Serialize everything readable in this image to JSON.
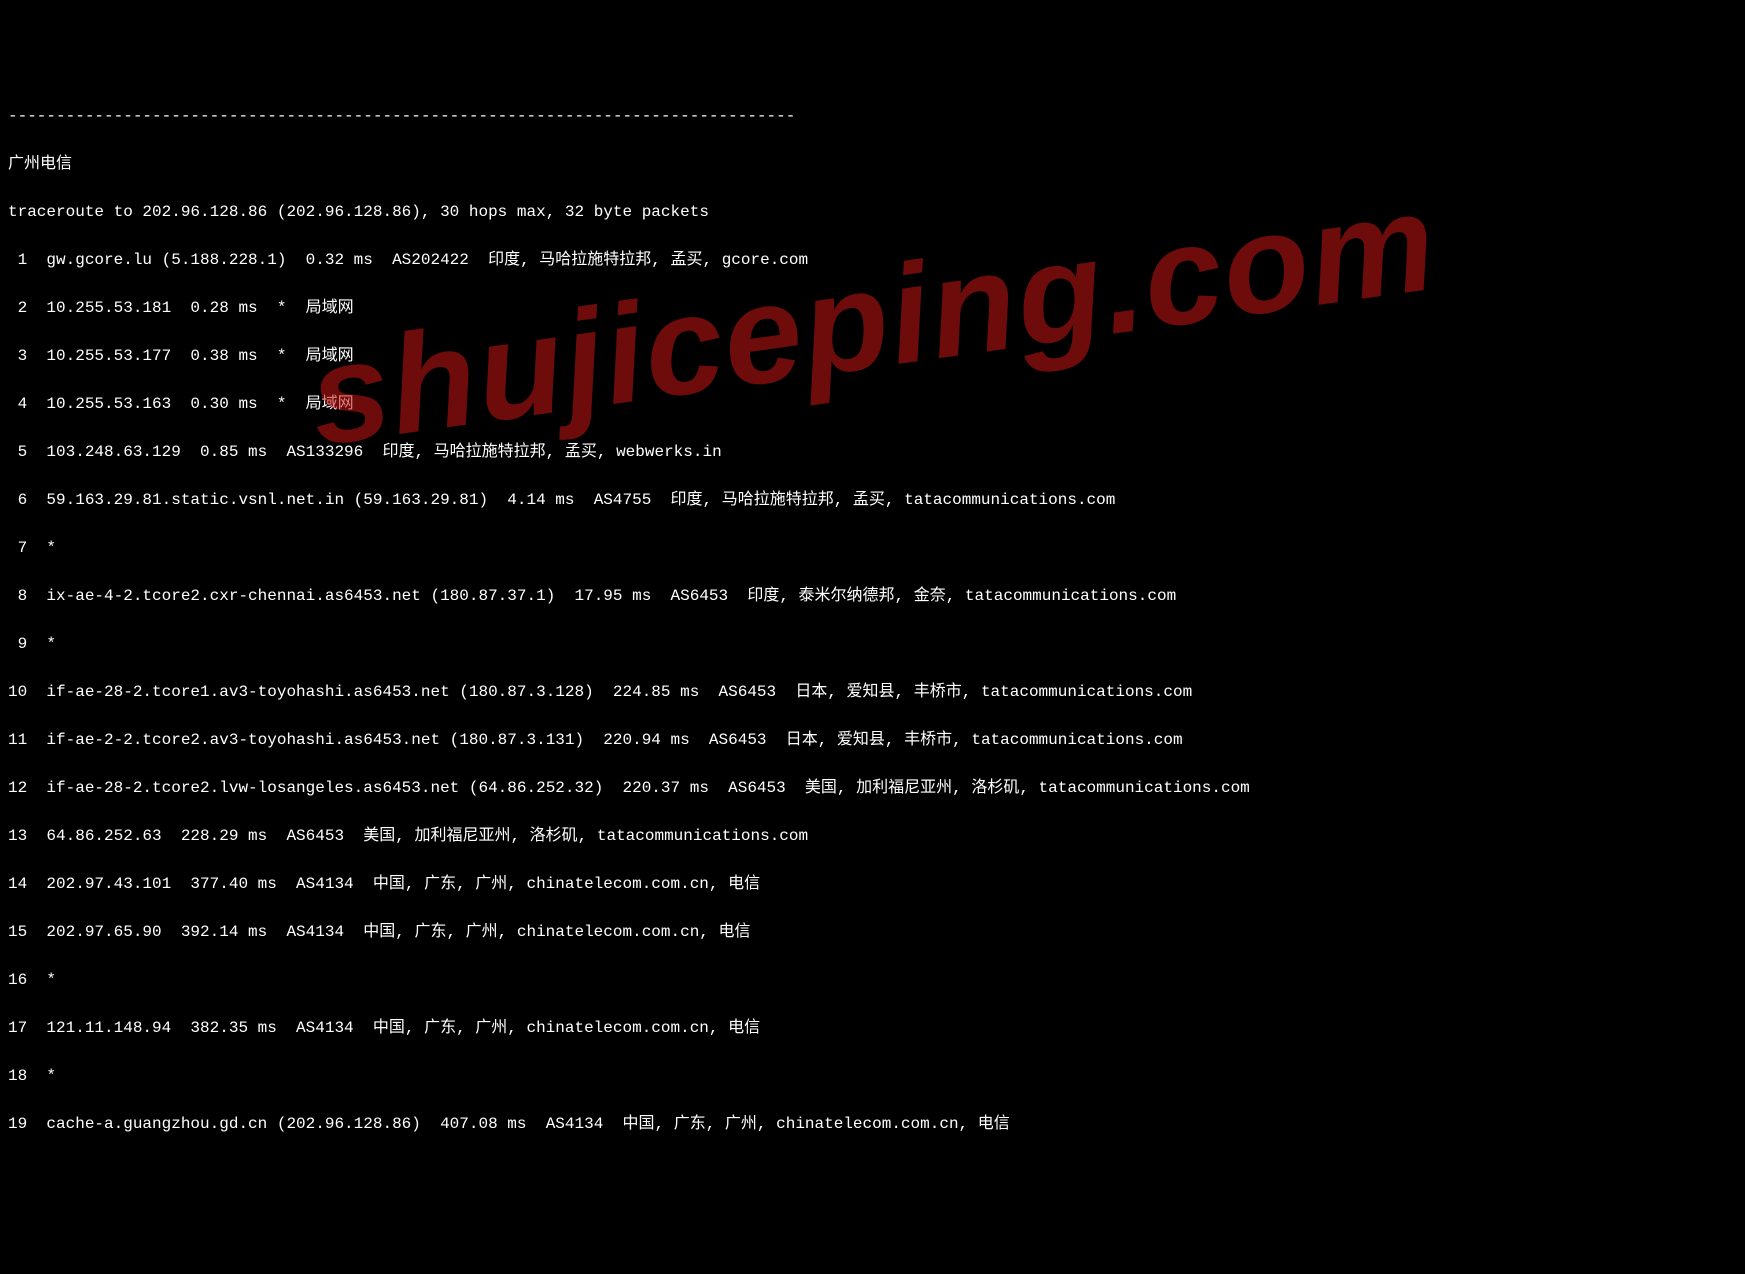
{
  "separator": "----------------------------------------------------------------------------------",
  "title": "广州电信",
  "header": "traceroute to 202.96.128.86 (202.96.128.86), 30 hops max, 32 byte packets",
  "watermark": "shujiceping.com",
  "hops": [
    " 1  gw.gcore.lu (5.188.228.1)  0.32 ms  AS202422  印度, 马哈拉施特拉邦, 孟买, gcore.com",
    " 2  10.255.53.181  0.28 ms  *  局域网",
    " 3  10.255.53.177  0.38 ms  *  局域网",
    " 4  10.255.53.163  0.30 ms  *  局域网",
    " 5  103.248.63.129  0.85 ms  AS133296  印度, 马哈拉施特拉邦, 孟买, webwerks.in",
    " 6  59.163.29.81.static.vsnl.net.in (59.163.29.81)  4.14 ms  AS4755  印度, 马哈拉施特拉邦, 孟买, tatacommunications.com",
    " 7  *",
    " 8  ix-ae-4-2.tcore2.cxr-chennai.as6453.net (180.87.37.1)  17.95 ms  AS6453  印度, 泰米尔纳德邦, 金奈, tatacommunications.com",
    " 9  *",
    "10  if-ae-28-2.tcore1.av3-toyohashi.as6453.net (180.87.3.128)  224.85 ms  AS6453  日本, 爱知县, 丰桥市, tatacommunications.com",
    "11  if-ae-2-2.tcore2.av3-toyohashi.as6453.net (180.87.3.131)  220.94 ms  AS6453  日本, 爱知县, 丰桥市, tatacommunications.com",
    "12  if-ae-28-2.tcore2.lvw-losangeles.as6453.net (64.86.252.32)  220.37 ms  AS6453  美国, 加利福尼亚州, 洛杉矶, tatacommunications.com",
    "13  64.86.252.63  228.29 ms  AS6453  美国, 加利福尼亚州, 洛杉矶, tatacommunications.com",
    "14  202.97.43.101  377.40 ms  AS4134  中国, 广东, 广州, chinatelecom.com.cn, 电信",
    "15  202.97.65.90  392.14 ms  AS4134  中国, 广东, 广州, chinatelecom.com.cn, 电信",
    "16  *",
    "17  121.11.148.94  382.35 ms  AS4134  中国, 广东, 广州, chinatelecom.com.cn, 电信",
    "18  *",
    "19  cache-a.guangzhou.gd.cn (202.96.128.86)  407.08 ms  AS4134  中国, 广东, 广州, chinatelecom.com.cn, 电信"
  ]
}
